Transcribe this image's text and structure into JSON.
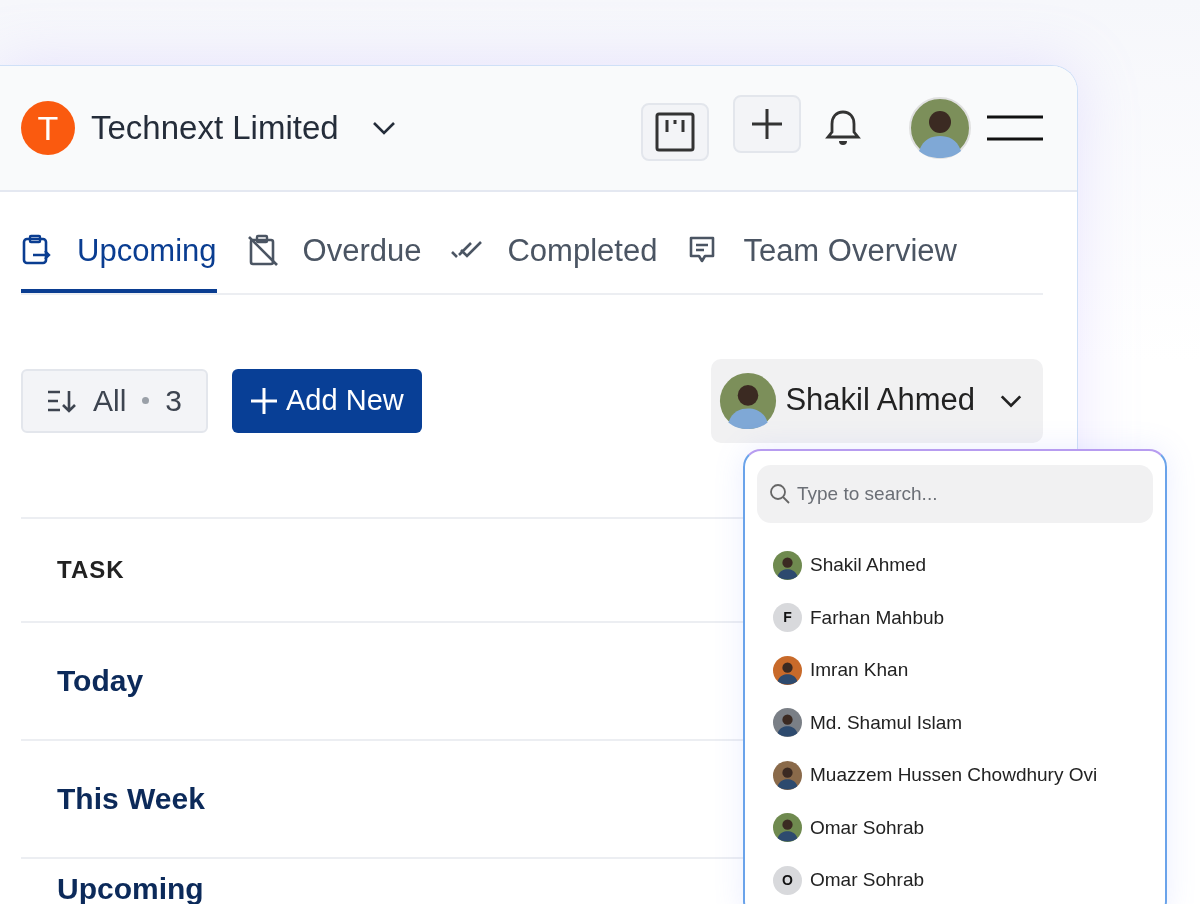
{
  "header": {
    "org_initial": "T",
    "org_name": "Technext Limited"
  },
  "tabs": [
    {
      "label": "Upcoming",
      "selected": true
    },
    {
      "label": "Overdue",
      "selected": false
    },
    {
      "label": "Completed",
      "selected": false
    },
    {
      "label": "Team Overview",
      "selected": false
    }
  ],
  "toolbar": {
    "filter_label": "All",
    "filter_count": "3",
    "add_button": "Add New",
    "assignee": "Shakil Ahmed"
  },
  "table": {
    "column_1": "TASK",
    "groups": [
      "Today",
      "This Week",
      "Upcoming"
    ]
  },
  "dropdown": {
    "search": {
      "placeholder": "Type to search..."
    },
    "members": [
      {
        "name": "Shakil Ahmed",
        "kind": "photo"
      },
      {
        "name": "Farhan Mahbub",
        "kind": "initial",
        "initial": "F"
      },
      {
        "name": "Imran Khan",
        "kind": "photo"
      },
      {
        "name": "Md. Shamul Islam",
        "kind": "photo"
      },
      {
        "name": "Muazzem Hussen Chowdhury Ovi",
        "kind": "photo"
      },
      {
        "name": "Omar Sohrab",
        "kind": "photo"
      },
      {
        "name": "Omar Sohrab",
        "kind": "initial",
        "initial": "O"
      }
    ]
  }
}
